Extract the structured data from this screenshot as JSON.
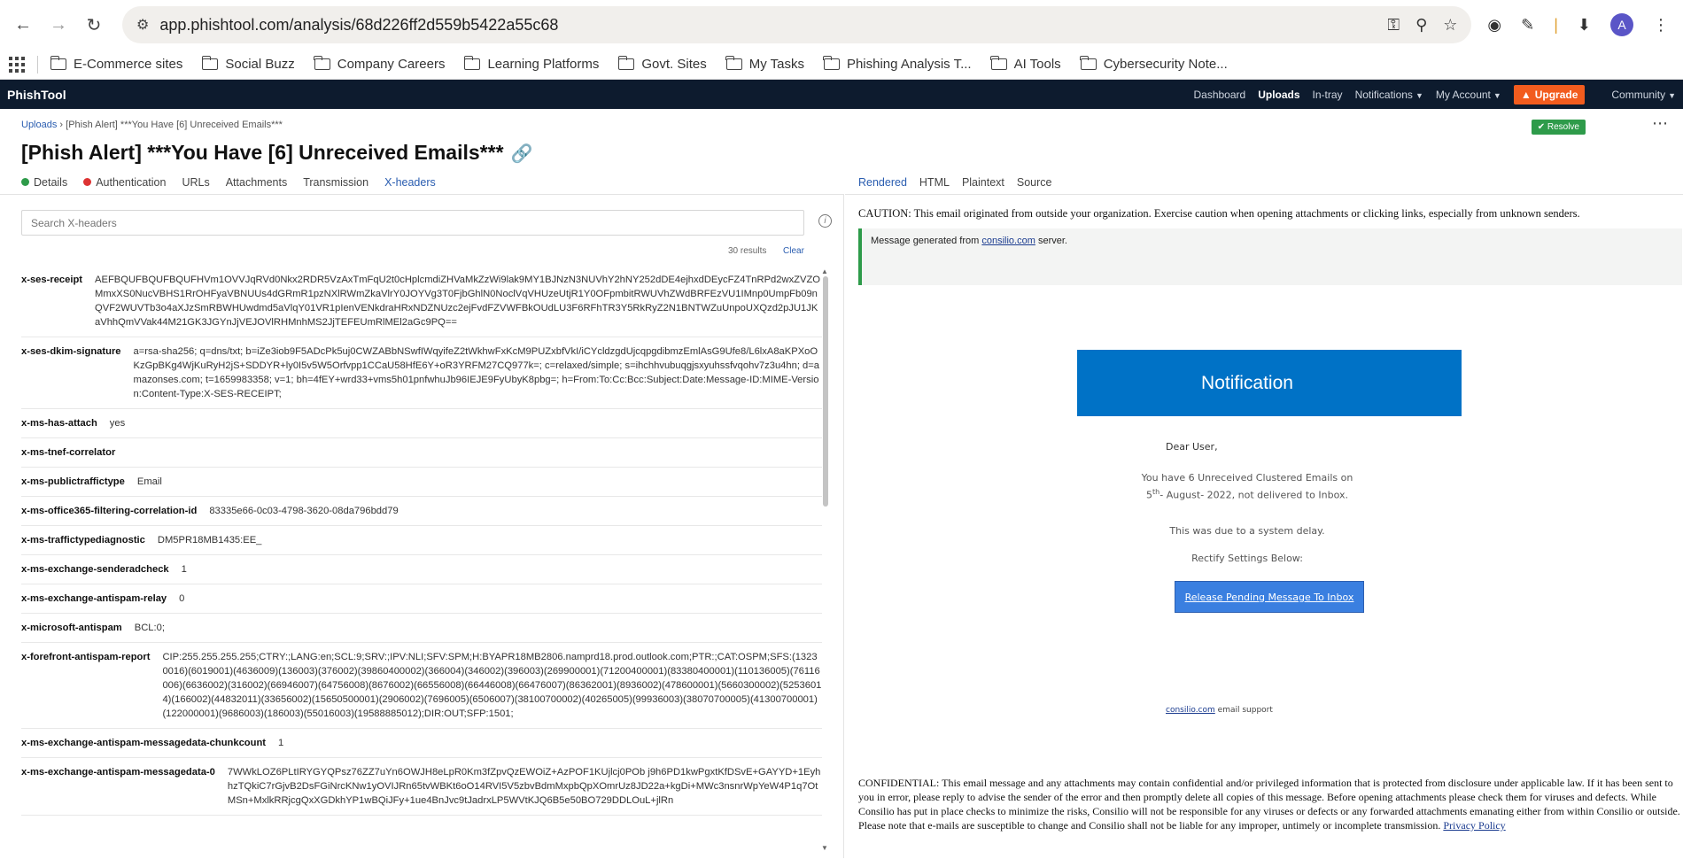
{
  "browser": {
    "url": "app.phishtool.com/analysis/68d226ff2d559b5422a55c68",
    "avatar_letter": "A",
    "bookmarks": [
      "E-Commerce sites",
      "Social Buzz",
      "Company Careers",
      "Learning Platforms",
      "Govt. Sites",
      "My Tasks",
      "Phishing Analysis T...",
      "AI Tools",
      "Cybersecurity Note..."
    ]
  },
  "app": {
    "brand": "PhishTool",
    "nav": {
      "dashboard": "Dashboard",
      "uploads": "Uploads",
      "intray": "In-tray",
      "notifications": "Notifications",
      "account": "My Account",
      "upgrade": "Upgrade",
      "community": "Community"
    }
  },
  "breadcrumb": {
    "root": "Uploads",
    "current": "[Phish Alert] ***You Have [6] Unreceived Emails***"
  },
  "resolve_label": "Resolve",
  "title": "[Phish Alert] ***You Have [6] Unreceived Emails***",
  "left_tabs": {
    "details": "Details",
    "authentication": "Authentication",
    "urls": "URLs",
    "attachments": "Attachments",
    "transmission": "Transmission",
    "xheaders": "X-headers"
  },
  "search": {
    "placeholder": "Search X-headers"
  },
  "results_text": "30 results",
  "clear_label": "Clear",
  "headers": [
    {
      "key": "x-ses-receipt",
      "value": "AEFBQUFBQUFBQUFHVm1OVVJqRVd0Nkx2RDR5VzAxTmFqU2t0cHplcmdiZHVaMkZzWi9lak9MY1BJNzN3NUVhY2hNY252dDE4ejhxdDEycFZ4TnRPd2wxZVZOMmxXS0NucVBHS1RrOHFyaVBNUUs4dGRmR1pzNXlRWmZkaVlrY0JOYVg3T0FjbGhlN0NoclVqVHUzeUtjR1Y0OFpmbitRWUVhZWdBRFEzVU1IMnp0UmpFb09nQVF2WUVTb3o4aXJzSmRBWHUwdmd5aVlqY01VR1pIenVENkdraHRxNDZNUzc2ejFvdFZVWFBkOUdLU3F6RFhTR3Y5RkRyZ2N1BNTWZuUnpoUXQzd2pJU1JKaVhhQmVVak44M21GK3JGYnJjVEJOVlRHMnhMS2JjTEFEUmRlMEl2aGc9PQ=="
    },
    {
      "key": "x-ses-dkim-signature",
      "value": "a=rsa-sha256; q=dns/txt; b=iZe3iob9F5ADcPk5uj0CWZABbNSwfIWqyifeZ2tWkhwFxKcM9PUZxbfVkI/iCYcldzgdUjcqpgdibmzEmlAsG9Ufe8/L6lxA8aKPXoOKzGpBKg4WjKuRyH2jS+SDDYR+ly0I5v5W5Orfvpp1CCaU58HfE6Y+oR3YRFM27CQ977k=; c=relaxed/simple; s=ihchhvubuqgjsxyuhssfvqohv7z3u4hn; d=amazonses.com; t=1659983358; v=1; bh=4fEY+wrd33+vms5h01pnfwhuJb96IEJE9FyUbyK8pbg=; h=From:To:Cc:Bcc:Subject:Date:Message-ID:MIME-Version:Content-Type:X-SES-RECEIPT;"
    },
    {
      "key": "x-ms-has-attach",
      "value": "yes"
    },
    {
      "key": "x-ms-tnef-correlator",
      "value": ""
    },
    {
      "key": "x-ms-publictraffictype",
      "value": "Email"
    },
    {
      "key": "x-ms-office365-filtering-correlation-id",
      "value": "83335e66-0c03-4798-3620-08da796bdd79"
    },
    {
      "key": "x-ms-traffictypediagnostic",
      "value": "DM5PR18MB1435:EE_"
    },
    {
      "key": "x-ms-exchange-senderadcheck",
      "value": "1"
    },
    {
      "key": "x-ms-exchange-antispam-relay",
      "value": "0"
    },
    {
      "key": "x-microsoft-antispam",
      "value": "BCL:0;"
    },
    {
      "key": "x-forefront-antispam-report",
      "value": "CIP:255.255.255.255;CTRY:;LANG:en;SCL:9;SRV:;IPV:NLI;SFV:SPM;H:BYAPR18MB2806.namprd18.prod.outlook.com;PTR:;CAT:OSPM;SFS:(13230016)(6019001)(4636009)(136003)(376002)(39860400002)(366004)(346002)(396003)(269900001)(71200400001)(83380400001)(110136005)(76116006)(6636002)(316002)(66946007)(64756008)(8676002)(66556008)(66446008)(66476007)(86362001)(8936002)(478600001)(5660300002)(52536014)(166002)(44832011)(33656002)(15650500001)(2906002)(7696005)(6506007)(38100700002)(40265005)(99936003)(38070700005)(41300700001)(122000001)(9686003)(186003)(55016003)(19588885012);DIR:OUT;SFP:1501;"
    },
    {
      "key": "x-ms-exchange-antispam-messagedata-chunkcount",
      "value": "1"
    },
    {
      "key": "x-ms-exchange-antispam-messagedata-0",
      "value": "7WWkLOZ6PLtIRYGYQPsz76ZZ7uYn6OWJH8eLpR0Km3fZpvQzEWOiZ+AzPOF1KUjlcj0POb j9h6PD1kwPgxtKfDSvE+GAYYD+1EyhhzTQkiC7rGjvB2DsFGiNrcKNw1yOVIJRn65tvWBKt6oO14RVI5V5zbvBdmMxpbQpXOmrUz8JD22a+kgDi+MWc3nsnrWpYeW4P1q7OtMSn+MxlkRRjcgQxXGDkhYP1wBQiJFy+1ue4BnJvc9tJadrxLP5WVtKJQ6B5e50BO729DDLOuL+jlRn"
    }
  ],
  "right_tabs": {
    "rendered": "Rendered",
    "html": "HTML",
    "plaintext": "Plaintext",
    "source": "Source"
  },
  "email": {
    "caution": "CAUTION: This email originated from outside your organization. Exercise caution when opening attachments or clicking links, especially from unknown senders.",
    "msg_gen_prefix": "Message generated from",
    "msg_gen_link": "consilio.com",
    "msg_gen_suffix": "server.",
    "notification_title": "Notification",
    "greeting": "Dear User,",
    "body_line1": "You have 6 Unreceived Clustered Emails on",
    "body_day": "5",
    "body_sup": "th",
    "body_line2": "- August- 2022, not delivered to Inbox.",
    "delay": "This was due to a system delay.",
    "rectify": "Rectify Settings Below:",
    "button": "Release Pending Message To Inbox",
    "support_link": "consilio.com",
    "support_text": "email support",
    "confidential": "CONFIDENTIAL: This email message and any attachments may contain confidential and/or privileged information that is protected from disclosure under applicable law. If it has been sent to you in error, please reply to advise the sender of the error and then promptly delete all copies of this message. Before opening attachments please check them for viruses and defects. While Consilio has put in place checks to minimize the risks, Consilio will not be responsible for any viruses or defects or any forwarded attachments emanating either from within Consilio or outside. Please note that e-mails are susceptible to change and Consilio shall not be liable for any improper, untimely or incomplete transmission.",
    "privacy": "Privacy Policy"
  }
}
